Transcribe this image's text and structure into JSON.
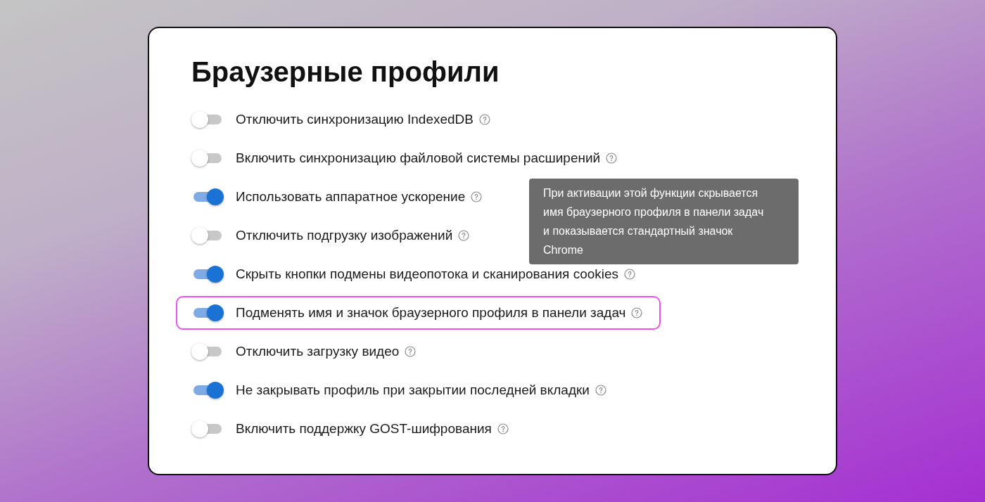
{
  "title": "Браузерные профили",
  "settings": [
    {
      "label": "Отключить синхронизацию IndexedDB",
      "on": false,
      "highlighted": false
    },
    {
      "label": "Включить синхронизацию файловой системы расширений",
      "on": false,
      "highlighted": false
    },
    {
      "label": "Использовать аппаратное ускорение",
      "on": true,
      "highlighted": false
    },
    {
      "label": "Отключить подгрузку изображений",
      "on": false,
      "highlighted": false
    },
    {
      "label": "Скрыть кнопки подмены видеопотока и сканирования cookies",
      "on": true,
      "highlighted": false
    },
    {
      "label": "Подменять имя и значок браузерного профиля в панели задач",
      "on": true,
      "highlighted": true
    },
    {
      "label": "Отключить загрузку видео",
      "on": false,
      "highlighted": false
    },
    {
      "label": "Не закрывать профиль при закрытии последней вкладки",
      "on": true,
      "highlighted": false
    },
    {
      "label": "Включить поддержку GOST-шифрования",
      "on": false,
      "highlighted": false
    }
  ],
  "tooltip": "При активации этой функции скрывается имя браузерного профиля в панели задач и показывается стандартный значок Chrome"
}
